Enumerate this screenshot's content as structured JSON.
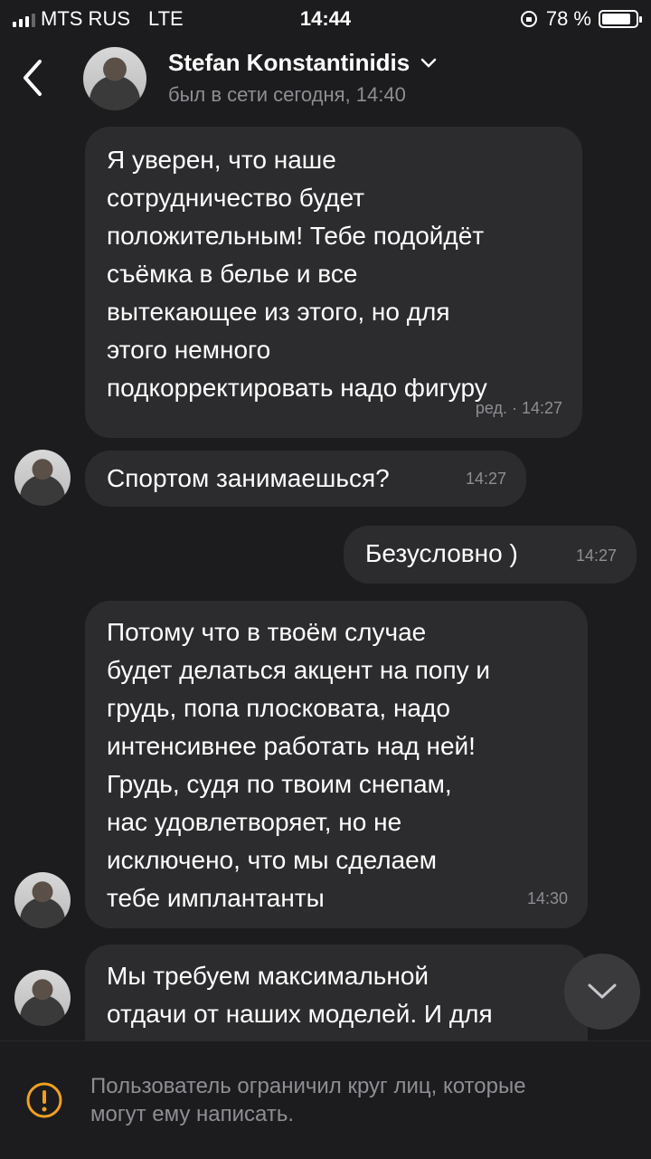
{
  "status": {
    "carrier": "MTS RUS",
    "network": "LTE",
    "time": "14:44",
    "battery": "78 %",
    "battery_level": 0.78
  },
  "header": {
    "contact_name": "Stefan Konstantinidis",
    "last_seen": "был в сети сегодня, 14:40"
  },
  "messages": [
    {
      "text": "Я уверен, что наше\nсотрудничество будет\nположительным! Тебе подойдёт\nсъёмка в белье и все\nвытекающее из этого, но для\nэтого немного\nподкорректировать надо фигуру",
      "meta": "ред. · 14:27",
      "direction": "in"
    },
    {
      "text": "Спортом занимаешься?",
      "meta": "14:27",
      "direction": "in"
    },
    {
      "text": "Безусловно )",
      "meta": "14:27",
      "direction": "out"
    },
    {
      "text": "Потому что в твоём случае\nбудет делаться акцент на попу и\nгрудь, попа плосковата, надо\nинтенсивнее работать над ней!\nГрудь, судя по твоим снепам,\nнас удовлетворяет, но не\nисключено, что мы сделаем\nтебе имплантанты",
      "meta": "14:30",
      "direction": "in"
    },
    {
      "text": "Мы требуем максимальной\nотдачи от наших моделей. И для",
      "meta": "",
      "direction": "in"
    }
  ],
  "footer": {
    "notice": "Пользователь ограничил круг лиц, которые\nмогут ему написать."
  },
  "colors": {
    "background": "#1c1c1e",
    "bubble": "#2c2c2e",
    "warning": "#f0a020"
  }
}
